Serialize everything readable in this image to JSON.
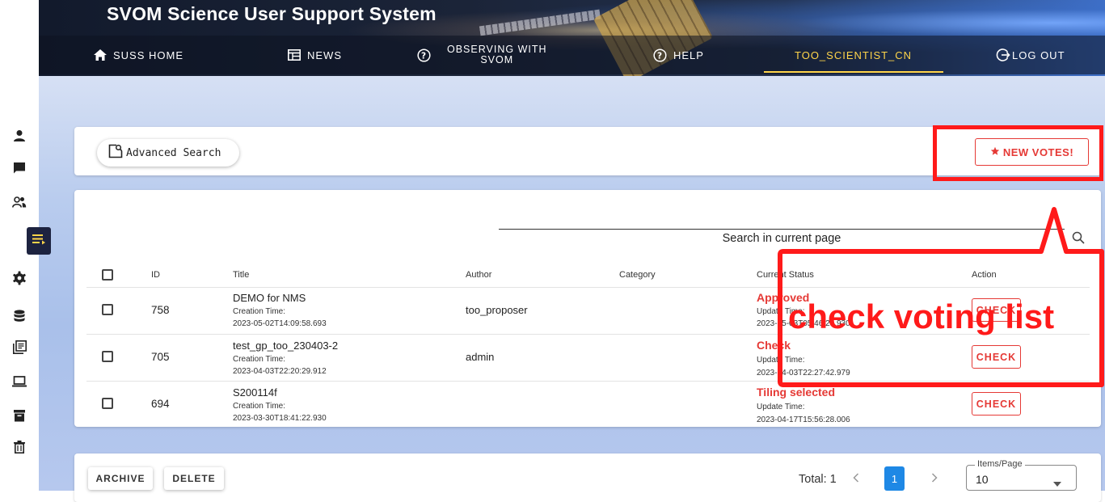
{
  "header": {
    "site_title": "SVOM Science User Support System",
    "nav": {
      "home": "SUSS HOME",
      "news": "NEWS",
      "observing_line1": "OBSERVING WITH",
      "observing_line2": "SVOM",
      "help": "HELP",
      "user": "TOO_SCIENTIST_CN",
      "logout": "LOG OUT"
    }
  },
  "toolbar": {
    "advanced_search": "Advanced Search",
    "new_votes": "NEW VOTES!"
  },
  "search": {
    "placeholder": "Search in current page"
  },
  "table": {
    "columns": {
      "id": "ID",
      "title": "Title",
      "author": "Author",
      "category": "Category",
      "status": "Current Status",
      "action": "Action"
    },
    "rows": [
      {
        "id": "758",
        "title": "DEMO for NMS",
        "creation_label": "Creation Time:",
        "creation_time": "2023-05-02T14:09:58.693",
        "author": "too_proposer",
        "category": "",
        "status": "Approved",
        "update_label": "Update Time:",
        "update_time": "2023-05-03T05:46:25.930",
        "action": "CHECK"
      },
      {
        "id": "705",
        "title": "test_gp_too_230403-2",
        "creation_label": "Creation Time:",
        "creation_time": "2023-04-03T22:20:29.912",
        "author": "admin",
        "category": "",
        "status": "Check",
        "update_label": "Update Time:",
        "update_time": "2023-04-03T22:27:42.979",
        "action": "CHECK"
      },
      {
        "id": "694",
        "title": "S200114f",
        "creation_label": "Creation Time:",
        "creation_time": "2023-03-30T18:41:22.930",
        "author": "",
        "category": "",
        "status": "Tiling selected",
        "update_label": "Update Time:",
        "update_time": "2023-04-17T15:56:28.006",
        "action": "CHECK"
      }
    ]
  },
  "footer": {
    "archive": "ARCHIVE",
    "delete": "DELETE",
    "total": "Total: 1",
    "current_page": "1",
    "items_per_page_label": "Items/Page",
    "items_per_page_value": "10"
  },
  "annotation": {
    "text": "check voting list",
    "color": "#ff1a1a"
  },
  "colors": {
    "accent_red": "#e53935",
    "nav_active": "#ffd54a",
    "sidebar_active": "#1d2340",
    "page_button": "#1e88e5"
  }
}
